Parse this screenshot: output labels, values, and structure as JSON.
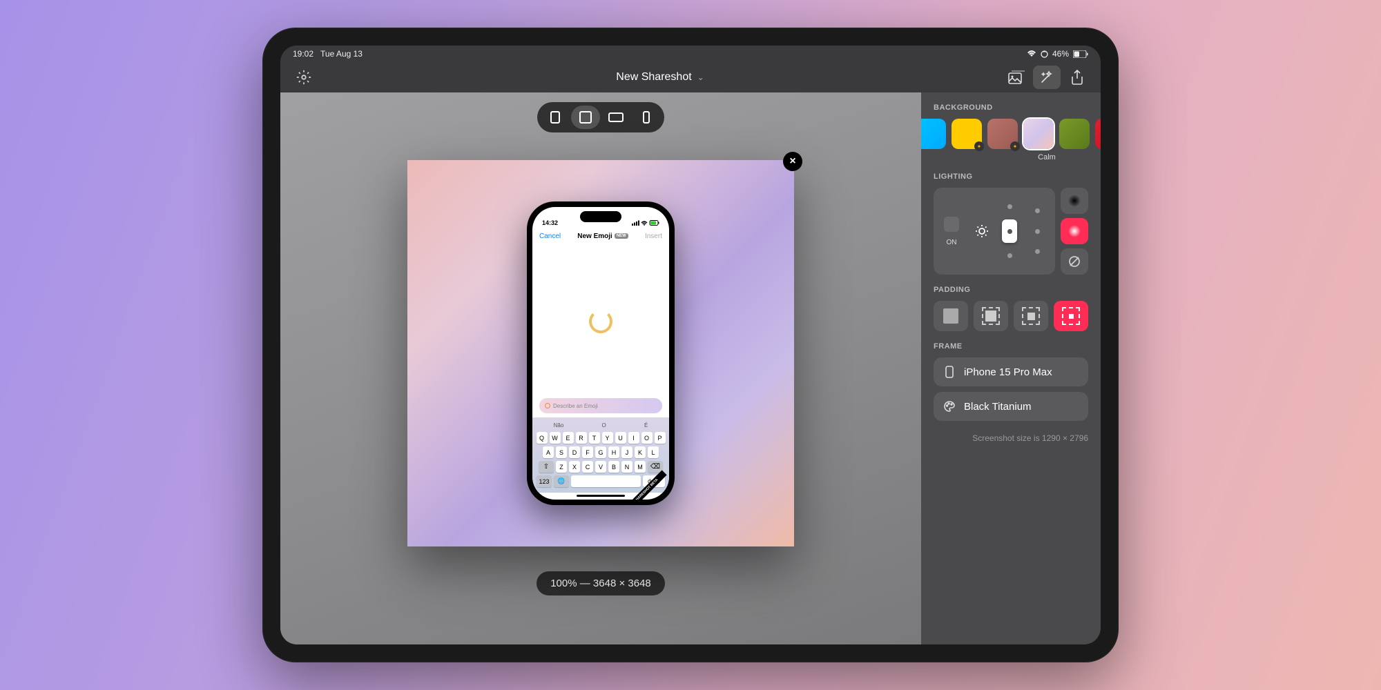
{
  "status": {
    "time": "19:02",
    "date": "Tue Aug 13",
    "battery": "46%"
  },
  "header": {
    "title": "New Shareshot"
  },
  "canvas": {
    "close": "×",
    "phone": {
      "time": "14:32",
      "nav_cancel": "Cancel",
      "nav_title": "New Emoji",
      "nav_badge": "NEW",
      "nav_insert": "Insert",
      "search_placeholder": "Describe an Emoji",
      "beta": "SHARESHOT BETA",
      "sug": [
        "Não",
        "O",
        "É"
      ],
      "r1": [
        "Q",
        "W",
        "E",
        "R",
        "T",
        "Y",
        "U",
        "I",
        "O",
        "P"
      ],
      "r2": [
        "A",
        "S",
        "D",
        "F",
        "G",
        "H",
        "J",
        "K",
        "L"
      ],
      "r3": [
        "Z",
        "X",
        "C",
        "V",
        "B",
        "N",
        "M"
      ],
      "k123": "123",
      "done": "done"
    },
    "zoom": "100% — 3648 × 3648"
  },
  "sidebar": {
    "background": {
      "label": "BACKGROUND",
      "selected_name": "Calm",
      "swatches": [
        {
          "bg": "linear-gradient(135deg,#00c2ff,#0af)",
          "preset": false
        },
        {
          "bg": "#ffcc00",
          "preset": true
        },
        {
          "bg": "linear-gradient(135deg,#b8736b,#9a5a52)",
          "preset": true
        },
        {
          "bg": "linear-gradient(135deg,#ead5ec,#d2c3ea,#f3c5b9)",
          "preset": false,
          "sel": true
        },
        {
          "bg": "linear-gradient(135deg,#7a9a2a,#5a7a1a)",
          "preset": false
        },
        {
          "bg": "linear-gradient(135deg,#e02030,#c01020)",
          "preset": false
        }
      ]
    },
    "lighting": {
      "label": "LIGHTING",
      "on": "ON"
    },
    "padding": {
      "label": "PADDING"
    },
    "frame": {
      "label": "FRAME",
      "device": "iPhone 15 Pro Max",
      "color": "Black Titanium"
    },
    "footer": "Screenshot size is 1290 × 2796"
  }
}
